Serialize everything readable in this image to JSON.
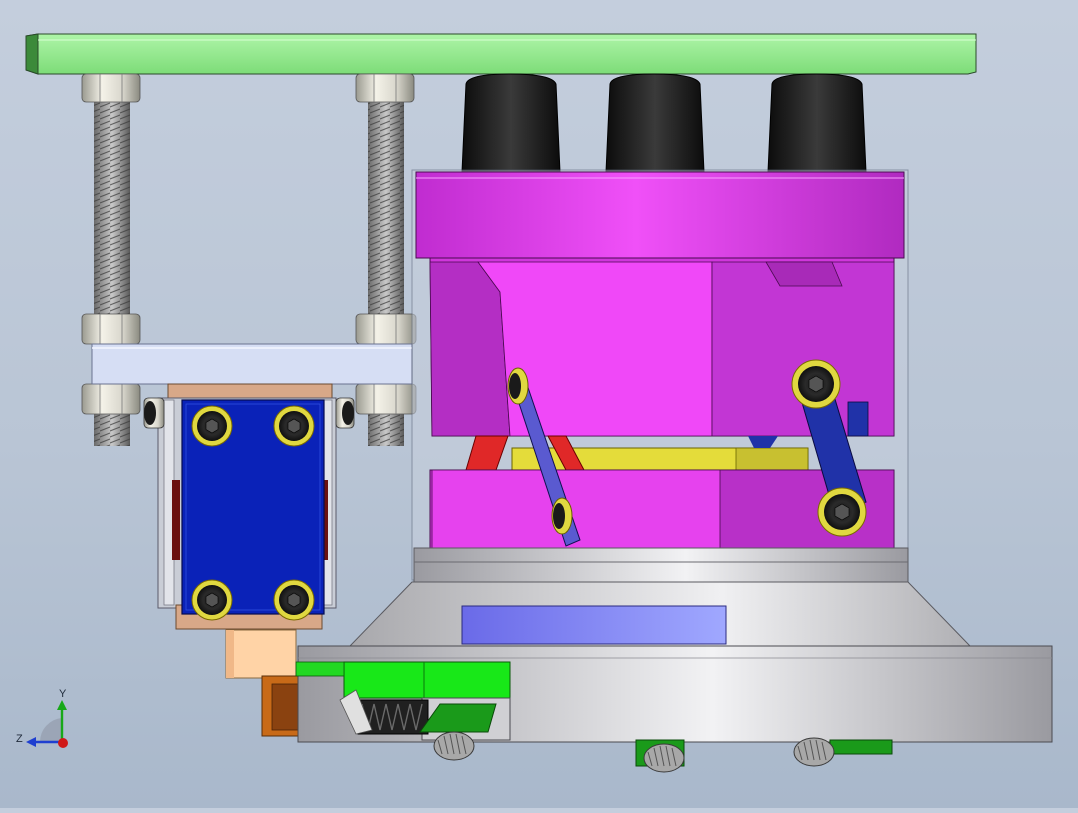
{
  "viewport": {
    "background_top": "#c4cedd",
    "background_bottom": "#a9b8cb"
  },
  "triad": {
    "y_label": "Y",
    "z_label": "Z",
    "y_color": "#18a818",
    "z_color": "#1f3fd0",
    "x_color": "#d01818"
  },
  "colors": {
    "top_plate": "#8ee88c",
    "magenta": "#e040e8",
    "magenta_dark": "#b02cc0",
    "blue_block": "#0a22b8",
    "link_blue": "#2030a0",
    "yellow_plate": "#e8e040",
    "red_link": "#e02828",
    "base_gray": "#c8c8cc",
    "green_part": "#18e818",
    "orange_part": "#c86a18",
    "peach_block": "#ffd0a0",
    "rubber_foot": "#1a1a1a",
    "brass": "#c8b400"
  }
}
